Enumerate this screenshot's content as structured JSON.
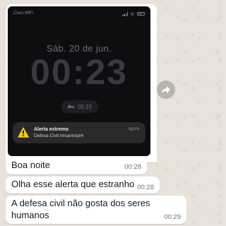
{
  "lockscreen": {
    "carrier": "Claro WiFi",
    "date": "Sáb. 20 de jun.",
    "time": "00:23",
    "widget_time": "05:10",
    "notification": {
      "title": "Alerta extremo",
      "body": "Defesa Civil:misantropi4",
      "time": "agora",
      "icon": "warning-icon"
    }
  },
  "messages": [
    {
      "text": "Boa noite",
      "time": "00:28"
    },
    {
      "text": "Olha esse alerta que estranho",
      "time": "00:28"
    },
    {
      "text": "A defesa civil não gosta dos seres humanos",
      "time": "00:29"
    }
  ],
  "colors": {
    "bubble": "#ffffff",
    "chat_background": "#e8e2da",
    "timestamp": "#667781",
    "warning": "#f5c518"
  }
}
